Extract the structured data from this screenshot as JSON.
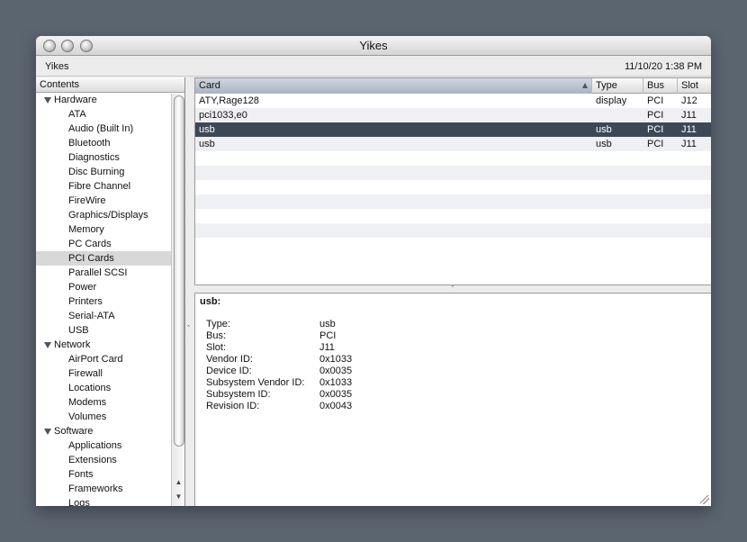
{
  "window": {
    "title": "Yikes",
    "toolbar_left": "Yikes",
    "toolbar_right": "11/10/20 1:38 PM"
  },
  "sidebar": {
    "header": "Contents",
    "groups": [
      {
        "label": "Hardware",
        "items": [
          "ATA",
          "Audio (Built In)",
          "Bluetooth",
          "Diagnostics",
          "Disc Burning",
          "Fibre Channel",
          "FireWire",
          "Graphics/Displays",
          "Memory",
          "PC Cards",
          "PCI Cards",
          "Parallel SCSI",
          "Power",
          "Printers",
          "Serial-ATA",
          "USB"
        ]
      },
      {
        "label": "Network",
        "items": [
          "AirPort Card",
          "Firewall",
          "Locations",
          "Modems",
          "Volumes"
        ]
      },
      {
        "label": "Software",
        "items": [
          "Applications",
          "Extensions",
          "Fonts",
          "Frameworks",
          "Logs"
        ]
      }
    ],
    "selected": "PCI Cards"
  },
  "table": {
    "columns": [
      "Card",
      "Type",
      "Bus",
      "Slot"
    ],
    "rows": [
      [
        "ATY,Rage128",
        "display",
        "PCI",
        "J12"
      ],
      [
        "pci1033,e0",
        "",
        "PCI",
        "J11"
      ],
      [
        "usb",
        "usb",
        "PCI",
        "J11"
      ],
      [
        "usb",
        "usb",
        "PCI",
        "J11"
      ]
    ],
    "selected_row": 2
  },
  "detail": {
    "title": "usb:",
    "fields": [
      [
        "Type:",
        "usb"
      ],
      [
        "Bus:",
        "PCI"
      ],
      [
        "Slot:",
        "J11"
      ],
      [
        "Vendor ID:",
        "0x1033"
      ],
      [
        "Device ID:",
        "0x0035"
      ],
      [
        "Subsystem Vendor ID:",
        "0x1033"
      ],
      [
        "Subsystem ID:",
        "0x0035"
      ],
      [
        "Revision ID:",
        "0x0043"
      ]
    ]
  },
  "colors": {
    "selection": "#3d4856",
    "sidebar_selection": "#d8d8d8",
    "desktop": "#5b6570"
  }
}
